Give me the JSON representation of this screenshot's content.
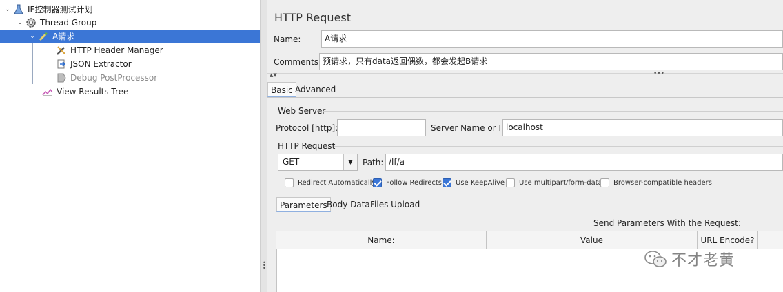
{
  "tree": {
    "items": [
      {
        "label": "IF控制器测试计划",
        "icon": "flask-icon"
      },
      {
        "label": "Thread Group",
        "icon": "gear-icon"
      },
      {
        "label": "A请求",
        "icon": "dropper-icon"
      },
      {
        "label": "HTTP Header Manager",
        "icon": "wrench-icon"
      },
      {
        "label": "JSON Extractor",
        "icon": "extractor-icon"
      },
      {
        "label": "Debug PostProcessor",
        "icon": "processor-icon"
      },
      {
        "label": "View Results Tree",
        "icon": "chart-icon"
      }
    ]
  },
  "panel": {
    "title": "HTTP Request",
    "name_label": "Name:",
    "name_value": "A请求",
    "comments_label": "Comments:",
    "comments_value": "预请求，只有data返回偶数，都会发起B请求",
    "tabs": [
      "Basic",
      "Advanced"
    ],
    "web_server": {
      "legend": "Web Server",
      "protocol_label": "Protocol [http]:",
      "protocol_value": "",
      "server_label": "Server Name or IP:",
      "server_value": "localhost"
    },
    "http_request": {
      "legend": "HTTP Request",
      "method": "GET",
      "path_label": "Path:",
      "path_value": "/lf/a"
    },
    "options": [
      {
        "label": "Redirect Automatically",
        "checked": false
      },
      {
        "label": "Follow Redirects",
        "checked": true
      },
      {
        "label": "Use KeepAlive",
        "checked": true
      },
      {
        "label": "Use multipart/form-data",
        "checked": false
      },
      {
        "label": "Browser-compatible headers",
        "checked": false
      }
    ],
    "subtabs": [
      "Parameters",
      "Body Data",
      "Files Upload"
    ],
    "send_params_label": "Send Parameters With the Request:",
    "columns": [
      "Name:",
      "Value",
      "URL Encode?"
    ]
  },
  "watermark": "不才老黄"
}
